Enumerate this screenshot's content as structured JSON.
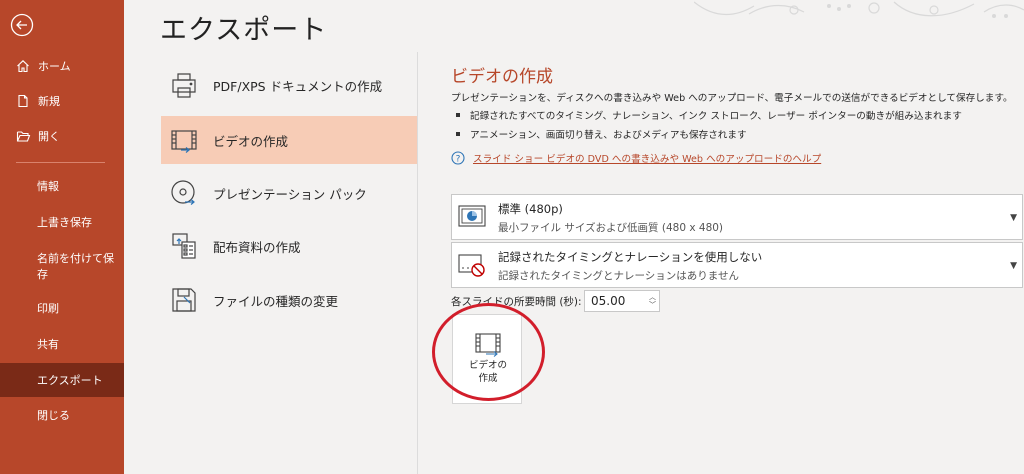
{
  "sidebar": {
    "items": [
      {
        "label": "ホーム",
        "icon": "home-icon"
      },
      {
        "label": "新規",
        "icon": "new-file-icon"
      },
      {
        "label": "開く",
        "icon": "folder-open-icon"
      }
    ],
    "sub_items": [
      "情報",
      "上書き保存",
      "名前を付けて保\n存",
      "印刷",
      "共有",
      "エクスポート",
      "閉じる"
    ],
    "active_item": "エクスポート",
    "colors": {
      "bg": "#b7472a",
      "active": "#7a2a17"
    }
  },
  "page": {
    "title": "エクスポート"
  },
  "export_options": [
    {
      "label": "PDF/XPS ドキュメントの作成",
      "icon": "pdf-document-icon"
    },
    {
      "label": "ビデオの作成",
      "icon": "video-icon",
      "selected": true
    },
    {
      "label": "プレゼンテーション パック",
      "icon": "cd-package-icon"
    },
    {
      "label": "配布資料の作成",
      "icon": "handouts-icon"
    },
    {
      "label": "ファイルの種類の変更",
      "icon": "file-type-icon"
    }
  ],
  "video_panel": {
    "title": "ビデオの作成",
    "description": "プレゼンテーションを、ディスクへの書き込みや Web へのアップロード、電子メールでの送信ができるビデオとして保存します。",
    "bullets": [
      "記録されたすべてのタイミング、ナレーション、インク ストローク、レーザー ポインターの動きが組み込まれます",
      "アニメーション、画面切り替え、およびメディアも保存されます"
    ],
    "help_link": "スライド ショー ビデオの DVD への書き込みや Web へのアップロードのヘルプ",
    "quality_dropdown": {
      "line1": "標準 (480p)",
      "line2": "最小ファイル サイズおよび低画質 (480 x 480)"
    },
    "timing_dropdown": {
      "line1": "記録されたタイミングとナレーションを使用しない",
      "line2": "記録されたタイミングとナレーションはありません"
    },
    "duration_label": "各スライドの所要時間 (秒):",
    "duration_value": "05.00",
    "create_button_label": "ビデオの\n作成",
    "accent_color": "#b7472a",
    "highlight_color": "#d21e2b"
  }
}
